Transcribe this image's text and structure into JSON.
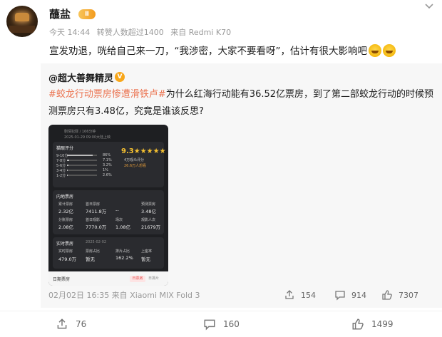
{
  "post": {
    "username": "蘸盐",
    "vip_badge": "Ⅱ",
    "time": "今天 14:44",
    "repost_count_text": "转赞人数超过1400",
    "source": "来自 Redmi K70",
    "text": "宣发劝退，咣给自己来一刀，“我涉密，大家不要看呀”，估计有很大影响吧"
  },
  "repost": {
    "user": "@超大善舞精灵",
    "verified_badge": "V",
    "hashtag": "#蛟龙行动票房惨遭滑铁卢#",
    "text": "为什么红海行动能有36.52亿票房，到了第二部蛟龙行动的时候预测票房只有3.48亿，究竟是谁该反思?",
    "meta": "02月02日 16:35 来自 Xiaomi MIX Fold 3",
    "share_count": "154",
    "comment_count": "914",
    "like_count": "7307",
    "image": {
      "header_left": "剧情犯罪 / 166分钟",
      "header_date": "2025-01-29 09:00大陆上映",
      "rating_title": "猫眼评分",
      "score": "9.3★★★★★",
      "score_sub": "4万观众评分",
      "score_rank": "26.6万人想看",
      "stars": [
        {
          "label": "9-10分",
          "pct": "86%"
        },
        {
          "label": "7-8分",
          "pct": "7.1%"
        },
        {
          "label": "5-6分",
          "pct": "3.2%"
        },
        {
          "label": "3-4分",
          "pct": "1%"
        },
        {
          "label": "1-2分",
          "pct": "2.6%"
        }
      ],
      "box_title": "内地票房",
      "box": [
        {
          "label": "累计票房",
          "value": "2.32亿"
        },
        {
          "label": "首日票房",
          "value": "7411.8万"
        },
        {
          "label": "",
          "value": "--"
        },
        {
          "label": "预测票房",
          "value": "3.48亿"
        }
      ],
      "box2": [
        {
          "label": "分账票房",
          "value": "2.08亿"
        },
        {
          "label": "首日观影",
          "value": "7770.0万"
        },
        {
          "label": "场次",
          "value": "1.08亿"
        },
        {
          "label": "观影人次",
          "value": "21679万"
        }
      ],
      "daily_title": "实时票房",
      "daily_date": "2025-02-02",
      "daily": [
        {
          "label": "实时票房",
          "value": "479.0万"
        },
        {
          "label": "票房占比",
          "value": "暂无"
        },
        {
          "label": "排片占比",
          "value": "162.2%"
        },
        {
          "label": "上座率",
          "value": "暂无"
        }
      ],
      "bottom_label": "日期票房",
      "bottom_pill": "日票房",
      "bottom_pill2": "日排片"
    }
  },
  "actions": {
    "share": "76",
    "comment": "160",
    "like": "1499"
  },
  "colors": {
    "hashtag": "#eb7350",
    "repost_bg": "#f7f7f7"
  },
  "icons": [
    "more-icon",
    "share-icon",
    "comment-icon",
    "like-icon",
    "vip-badge-icon",
    "verified-icon"
  ]
}
